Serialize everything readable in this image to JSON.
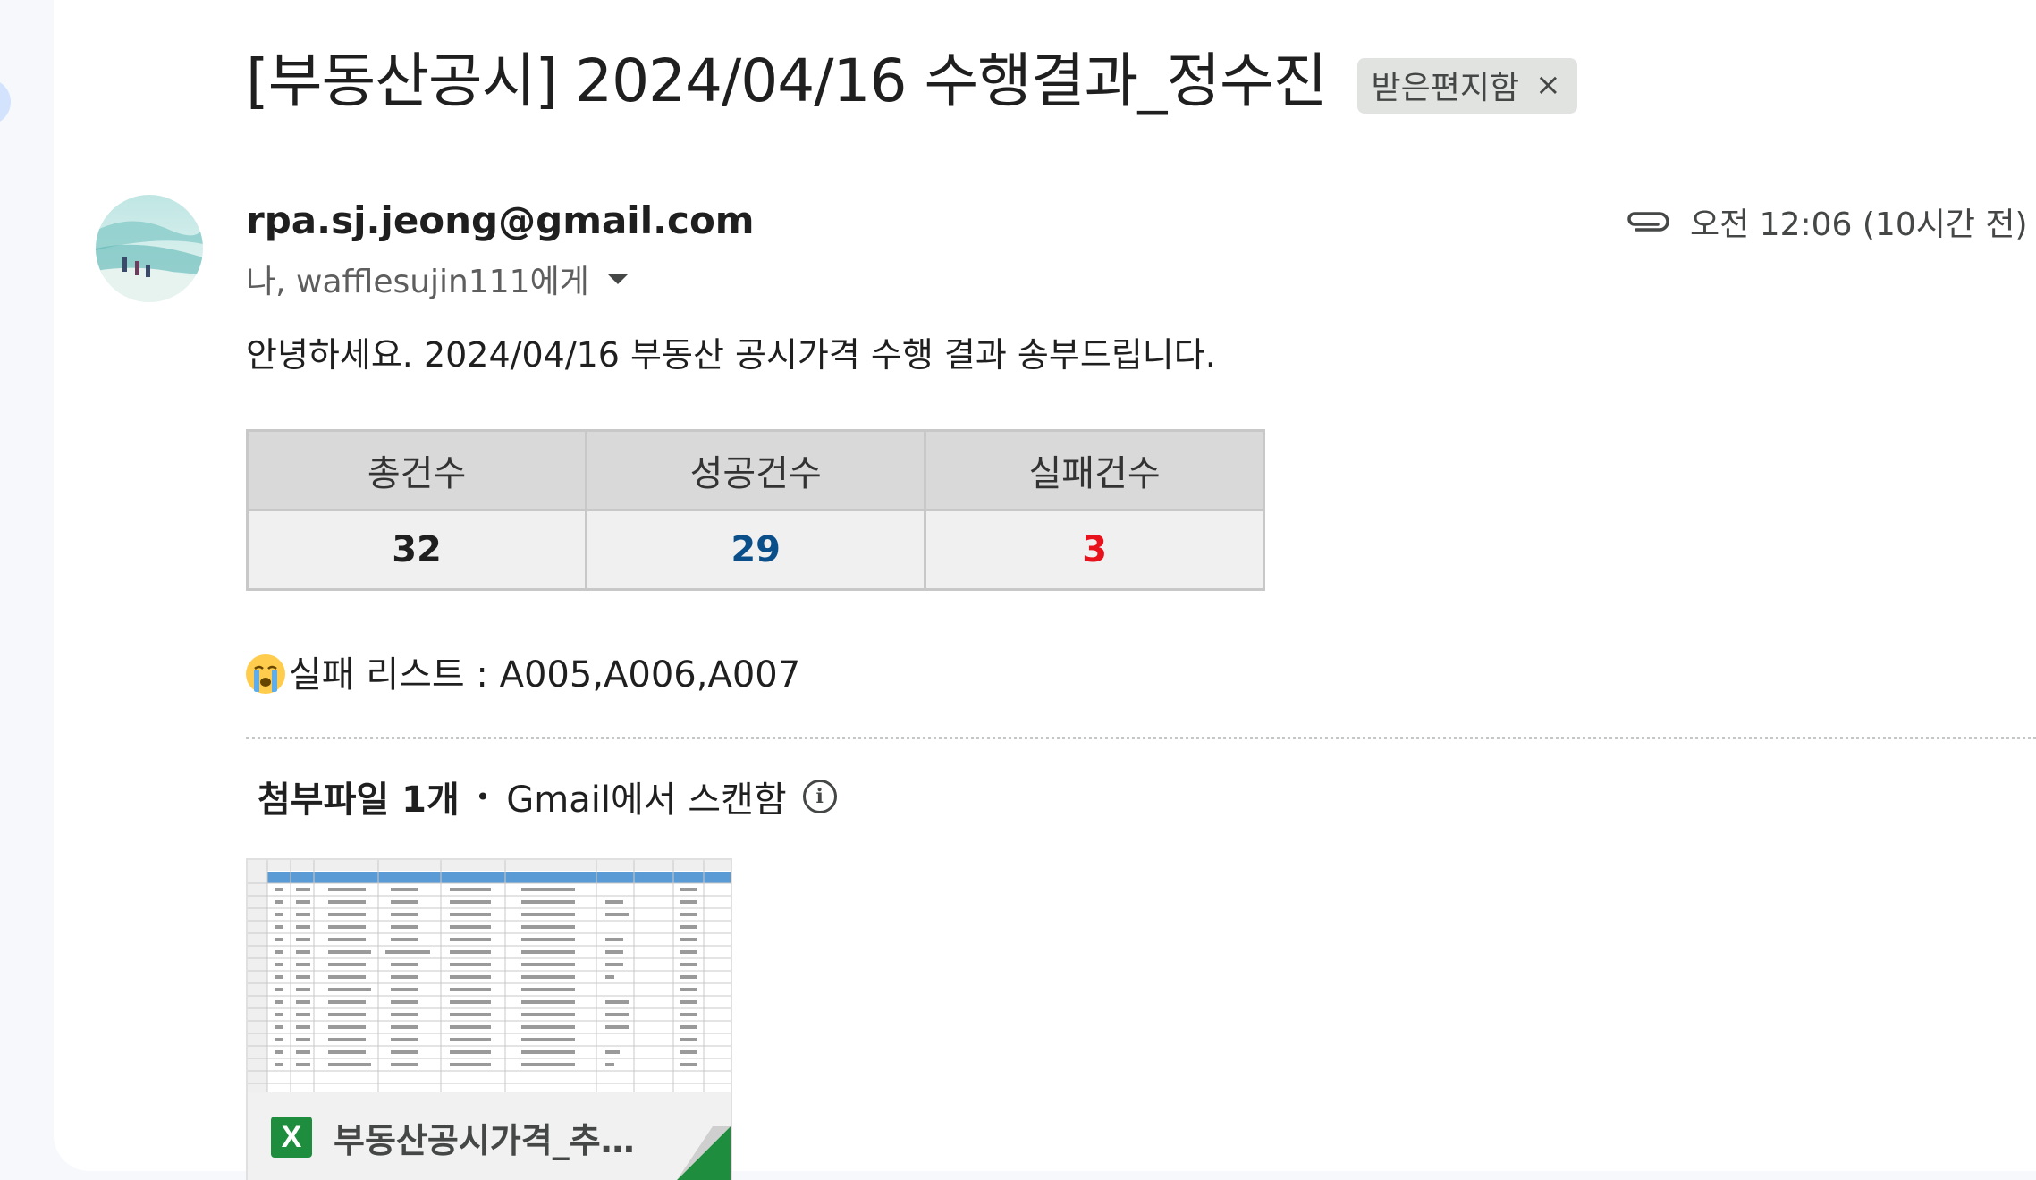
{
  "email": {
    "subject": "[부동산공시] 2024/04/16 수행결과_정수진",
    "label": "받은편지함",
    "label_remove": "×",
    "sender": "rpa.sj.jeong@gmail.com",
    "recipients": "나, wafflesujin111에게",
    "time": "오전 12:06 (10시간 전)",
    "body_text": "안녕하세요. 2024/04/16 부동산 공시가격 수행 결과 송부드립니다.",
    "stats": {
      "headers": [
        "총건수",
        "성공건수",
        "실패건수"
      ],
      "values": [
        "32",
        "29",
        "3"
      ],
      "colors": [
        "#1f1f1f",
        "#0b4f8a",
        "#e8121c"
      ]
    },
    "fail_list": "실패 리스트 : A005,A006,A007",
    "attachments": {
      "count_label": "첨부파일 1개",
      "separator": "•",
      "scan_label": "Gmail에서 스캔함",
      "file_name": "부동산공시가격_추...",
      "file_icon": "excel-icon"
    }
  }
}
